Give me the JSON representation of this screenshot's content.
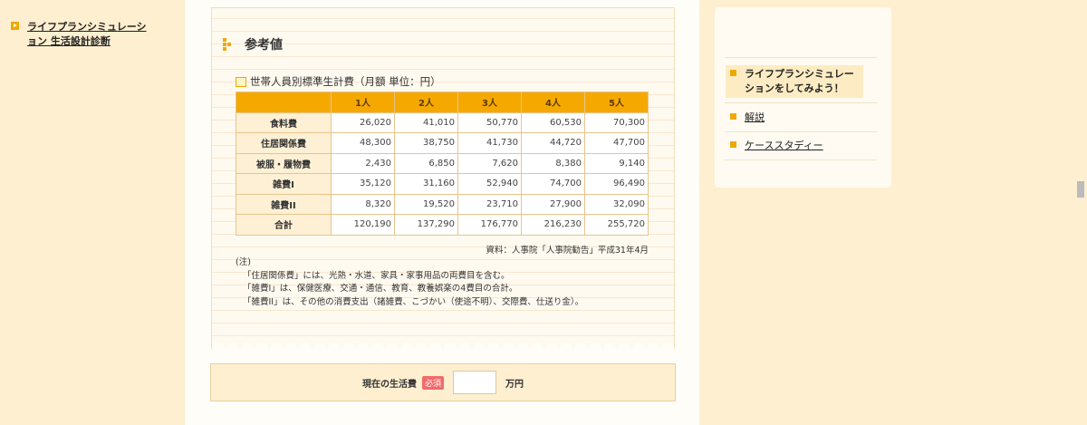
{
  "section": {
    "title": "参考値"
  },
  "table": {
    "caption": "世帯人員別標準生計費（月額 単位：円）",
    "headers": [
      "1人",
      "2人",
      "3人",
      "4人",
      "5人"
    ],
    "rows": [
      {
        "label": "食料費",
        "values": [
          "26,020",
          "41,010",
          "50,770",
          "60,530",
          "70,300"
        ]
      },
      {
        "label": "住居関係費",
        "values": [
          "48,300",
          "38,750",
          "41,730",
          "44,720",
          "47,700"
        ]
      },
      {
        "label": "被服・履物費",
        "values": [
          "2,430",
          "6,850",
          "7,620",
          "8,380",
          "9,140"
        ]
      },
      {
        "label": "雑費I",
        "values": [
          "35,120",
          "31,160",
          "52,940",
          "74,700",
          "96,490"
        ]
      },
      {
        "label": "雑費II",
        "values": [
          "8,320",
          "19,520",
          "23,710",
          "27,900",
          "32,090"
        ]
      },
      {
        "label": "合計",
        "values": [
          "120,190",
          "137,290",
          "176,770",
          "216,230",
          "255,720"
        ]
      }
    ],
    "source": "資料：人事院「人事院勧告」平成31年4月"
  },
  "notes": {
    "title": "(注)",
    "lines": [
      "「住居関係費」には、光熱・水道、家具・家事用品の両費目を含む。",
      "「雑費I」は、保健医療、交通・通信、教育、教養娯楽の4費目の合計。",
      "「雑費II」は、その他の消費支出（諸雑費、こづかい（使途不明）、交際費、仕送り金）。"
    ]
  },
  "form": {
    "label": "現在の生活費",
    "required": "必須",
    "value": "",
    "unit": "万円"
  },
  "sidebar": {
    "items": [
      {
        "label": "ライフプランシミュレーション 生活設計診断",
        "icon": "play-icon"
      },
      {
        "label": "ライフプランシミュレーションをしてみよう！",
        "icon": "square-bullet-icon"
      },
      {
        "label": "解説",
        "icon": "square-bullet-icon"
      },
      {
        "label": "ケーススタディー",
        "icon": "square-bullet-icon"
      }
    ]
  },
  "colors": {
    "accent": "#f5a800",
    "background": "#fdefcf",
    "required": "#f26b6b"
  }
}
